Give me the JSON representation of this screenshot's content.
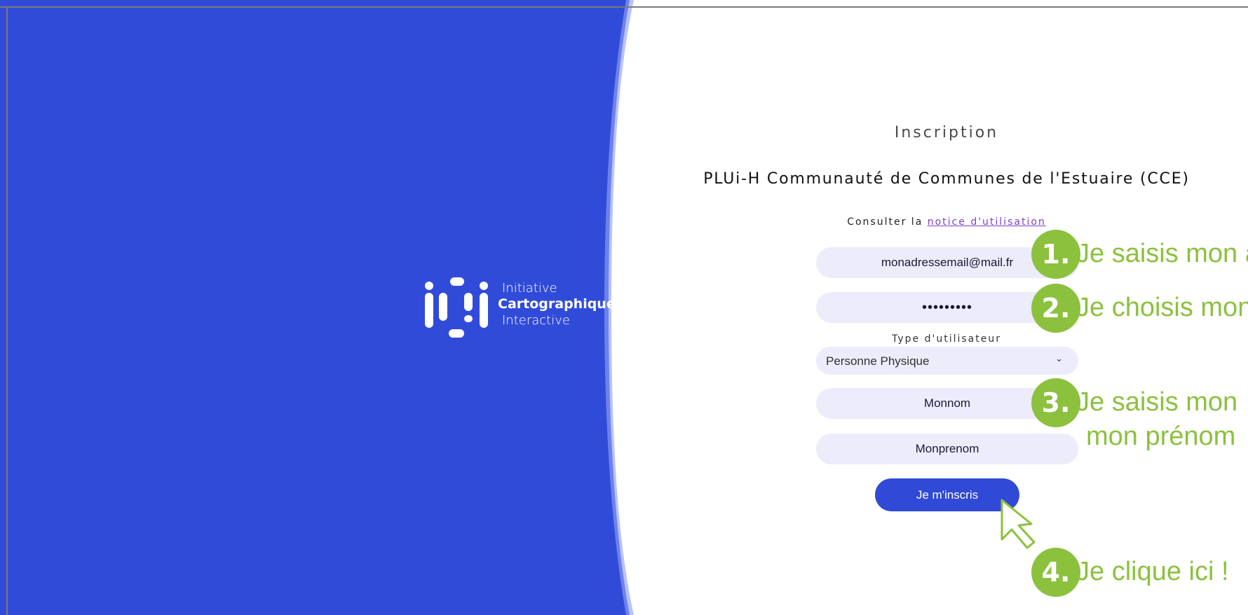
{
  "form": {
    "title": "Inscription",
    "subtitle": "PLUi-H Communauté de Communes de l'Estuaire (CCE)",
    "notice_prefix": "Consulter la",
    "notice_link": "notice d'utilisation",
    "email_value": "monadressemail@mail.fr",
    "password_value": "•••••••••",
    "user_type_label": "Type d'utilisateur",
    "user_type_selected": "Personne Physique",
    "nom_value": "Monnom",
    "prenom_value": "Monprenom",
    "submit_label": "Je m'inscris"
  },
  "logo": {
    "line1": "Initiative",
    "line2": "Cartographique",
    "line3": "Interactive"
  },
  "annotations": [
    {
      "number": "1.",
      "text": "Je saisis mon a"
    },
    {
      "number": "2.",
      "text": "Je choisis mon"
    },
    {
      "number": "3.",
      "text": "Je saisis mon",
      "text2": "mon prénom"
    },
    {
      "number": "4.",
      "text": "Je clique ici !"
    }
  ],
  "colors": {
    "brand_blue": "#3149d7",
    "accent_green": "#8cc13e",
    "field_bg": "#ececfb"
  },
  "icons": {
    "select_chevron": "chevron-down-icon",
    "cursor": "mouse-pointer-icon"
  }
}
